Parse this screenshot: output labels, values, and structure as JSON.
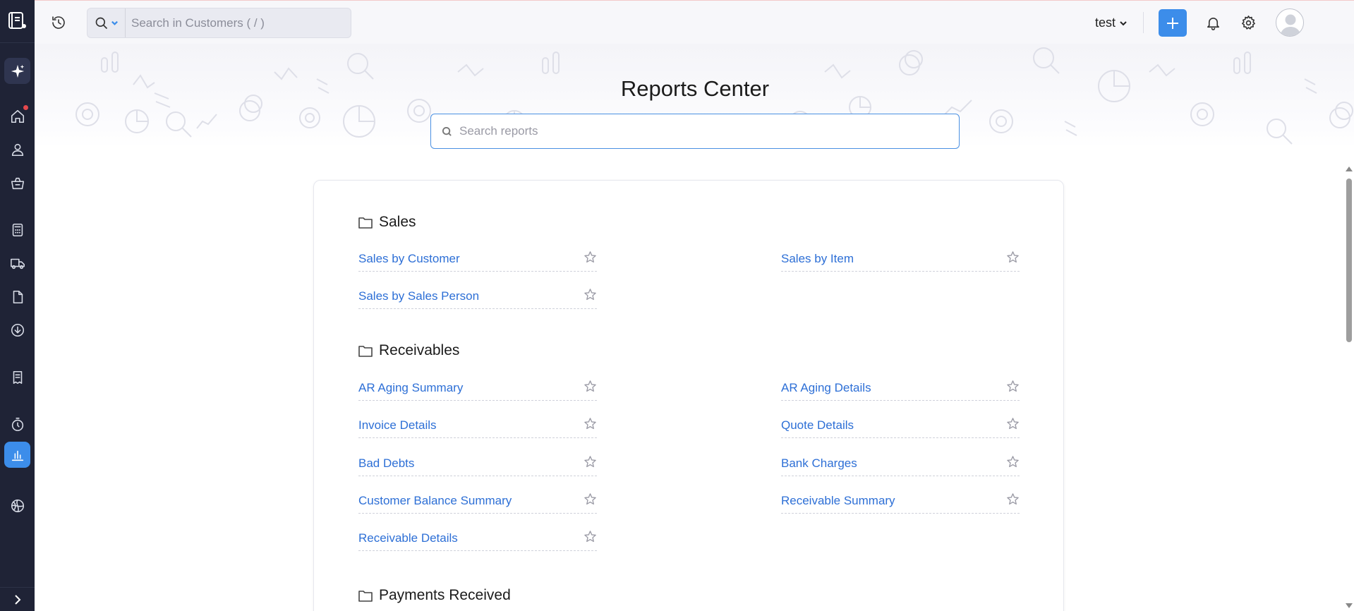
{
  "topbar": {
    "search_placeholder": "Search in Customers ( / )",
    "org_name": "test"
  },
  "hero": {
    "title": "Reports Center",
    "search_placeholder": "Search reports"
  },
  "sections": [
    {
      "title": "Sales",
      "reports": [
        "Sales by Customer",
        "Sales by Item",
        "Sales by Sales Person"
      ]
    },
    {
      "title": "Receivables",
      "reports": [
        "AR Aging Summary",
        "AR Aging Details",
        "Invoice Details",
        "Quote Details",
        "Bad Debts",
        "Bank Charges",
        "Customer Balance Summary",
        "Receivable Summary",
        "Receivable Details"
      ]
    },
    {
      "title": "Payments Received",
      "reports": []
    }
  ],
  "colors": {
    "accent": "#3c8dea",
    "sidebar_bg": "#1f2336",
    "link": "#2d6fd6"
  },
  "icons": {
    "sidebar": [
      "app-logo-icon",
      "sparkle-icon",
      "home-icon",
      "customer-icon",
      "basket-icon",
      "calculator-icon",
      "truck-icon",
      "document-icon",
      "download-icon",
      "receipt-icon",
      "timer-icon",
      "reports-icon",
      "globe-icon",
      "chevron-right-icon"
    ]
  }
}
